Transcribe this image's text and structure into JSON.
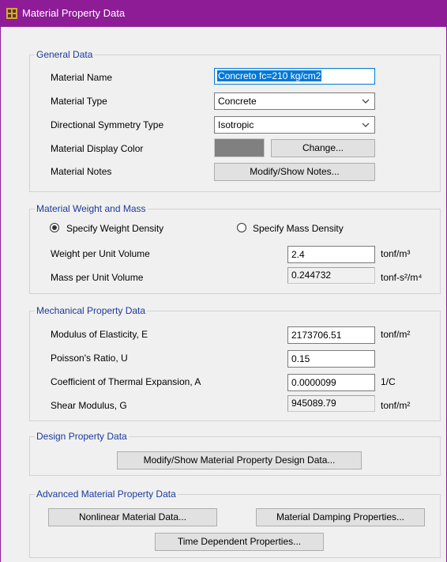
{
  "window": {
    "title": "Material Property Data"
  },
  "general": {
    "legend": "General Data",
    "material_name_label": "Material Name",
    "material_name_value": "Concreto fc=210 kg/cm2",
    "material_type_label": "Material Type",
    "material_type_value": "Concrete",
    "symmetry_label": "Directional Symmetry Type",
    "symmetry_value": "Isotropic",
    "display_color_label": "Material Display Color",
    "display_color": "#808080",
    "change_button": "Change...",
    "notes_label": "Material Notes",
    "notes_button": "Modify/Show Notes..."
  },
  "weight_mass": {
    "legend": "Material Weight and Mass",
    "radio_weight_label": "Specify Weight Density",
    "radio_weight_selected": true,
    "radio_mass_label": "Specify Mass Density",
    "radio_mass_selected": false,
    "weight_label": "Weight per Unit Volume",
    "weight_value": "2.4",
    "weight_unit": "tonf/m³",
    "mass_label": "Mass per Unit Volume",
    "mass_value": "0.244732",
    "mass_unit": "tonf-s²/m⁴"
  },
  "mechanical": {
    "legend": "Mechanical Property Data",
    "modulus_label": "Modulus of Elasticity,  E",
    "modulus_value": "2173706.51",
    "modulus_unit": "tonf/m²",
    "poisson_label": "Poisson's Ratio,  U",
    "poisson_value": "0.15",
    "thermal_label": "Coefficient of Thermal Expansion,  A",
    "thermal_value": "0.0000099",
    "thermal_unit": "1/C",
    "shear_label": "Shear Modulus,  G",
    "shear_value": "945089.79",
    "shear_unit": "tonf/m²"
  },
  "design": {
    "legend": "Design Property Data",
    "design_button": "Modify/Show Material Property Design Data..."
  },
  "advanced": {
    "legend": "Advanced Material Property Data",
    "nonlinear_button": "Nonlinear Material Data...",
    "damping_button": "Material Damping Properties...",
    "time_button": "Time Dependent Properties..."
  },
  "colors": {
    "titlebar": "#8d1c96",
    "legend_text": "#1b3a9c",
    "selection": "#0078d7"
  }
}
